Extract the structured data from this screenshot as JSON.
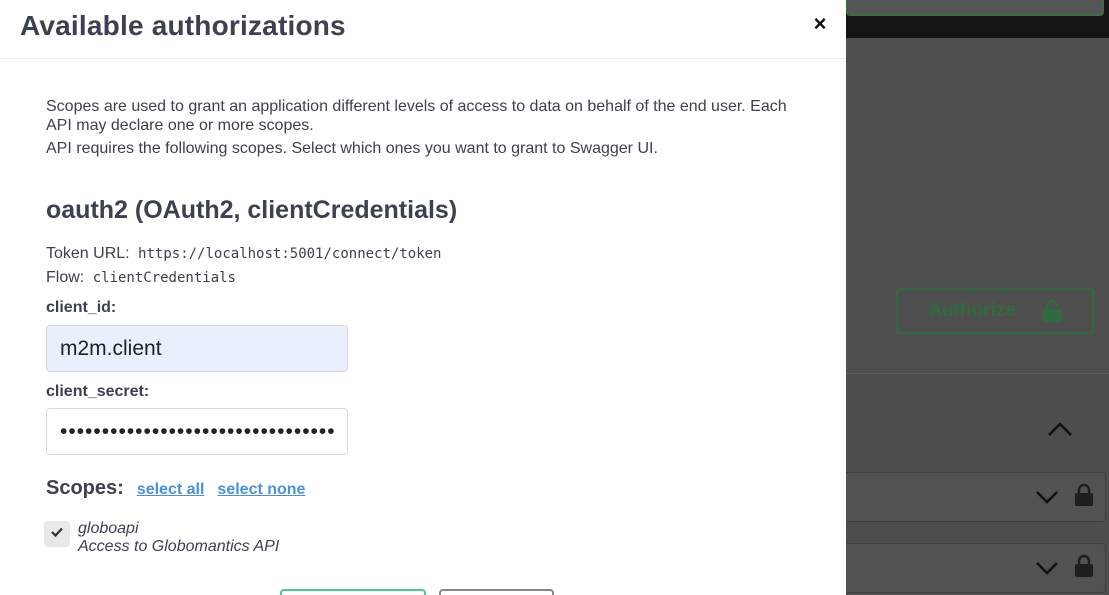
{
  "modal": {
    "title": "Available authorizations",
    "close_symbol": "×",
    "description_line1": "Scopes are used to grant an application different levels of access to data on behalf of the end user. Each API may declare one or more scopes.",
    "description_line2": "API requires the following scopes. Select which ones you want to grant to Swagger UI.",
    "scheme_title": "oauth2 (OAuth2, clientCredentials)",
    "token_url_label": "Token URL:",
    "token_url": "https://localhost:5001/connect/token",
    "flow_label": "Flow:",
    "flow": "clientCredentials",
    "client_id_label": "client_id:",
    "client_id_value": "m2m.client",
    "client_secret_label": "client_secret:",
    "client_secret_masked": "••••••••••••••••••••••••••••••••••",
    "scopes_label": "Scopes:",
    "select_all": "select all",
    "select_none": "select none",
    "scopes": [
      {
        "name": "globoapi",
        "description": "Access to Globomantics API",
        "checked": true
      }
    ]
  },
  "background": {
    "authorize_label": "Authorize"
  },
  "icons": {
    "close": "close-icon",
    "check": "check-icon",
    "lock": "lock-icon",
    "chevron_down": "chevron-down-icon",
    "chevron_up": "chevron-up-icon"
  },
  "colors": {
    "overlay": "#4d4d4d",
    "link": "#4990e2",
    "authorize_green": "#49cc90",
    "text": "#3b4151",
    "autofill_bg": "#e8f0fe"
  }
}
